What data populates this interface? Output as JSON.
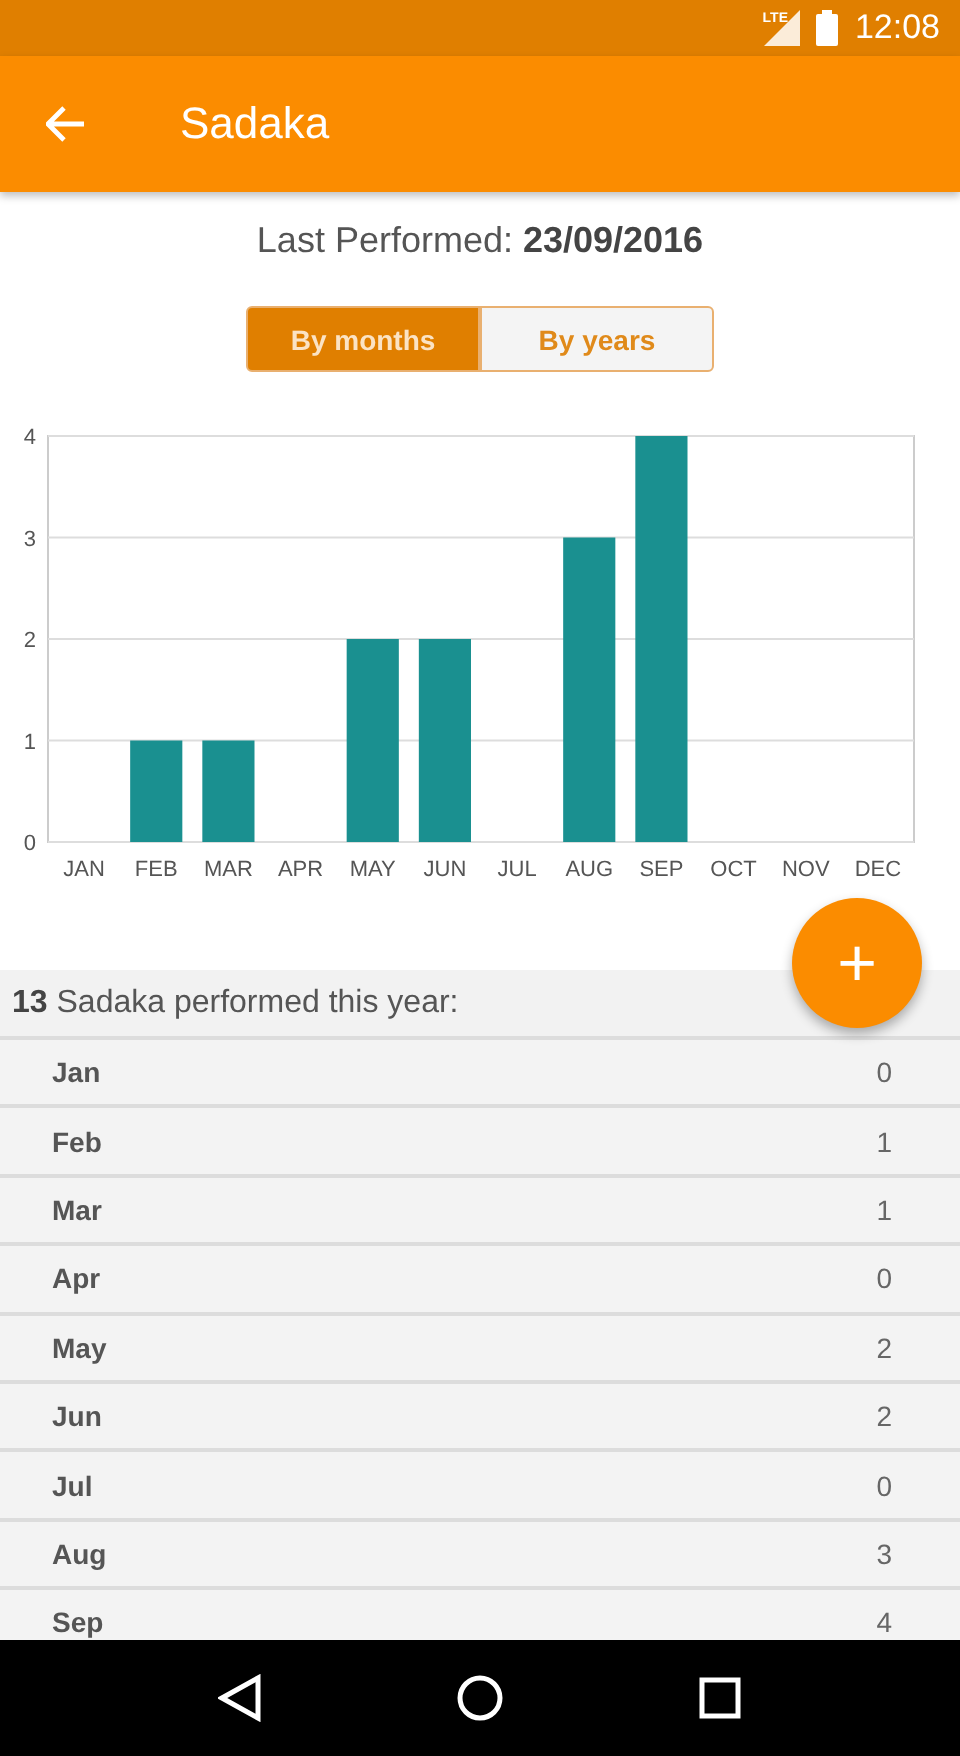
{
  "status_bar": {
    "network": "LTE",
    "time": "12:08"
  },
  "app_bar": {
    "title": "Sadaka"
  },
  "last_performed": "Last Performed: **23/09/2016**",
  "tabs": [
    {
      "label": "By months",
      "selected": true
    },
    {
      "label": "By years",
      "selected": false
    }
  ],
  "chart_data": {
    "type": "bar",
    "categories": [
      "JAN",
      "FEB",
      "MAR",
      "APR",
      "MAY",
      "JUN",
      "JUL",
      "AUG",
      "SEP",
      "OCT",
      "NOV",
      "DEC"
    ],
    "grid": true,
    "series": [
      {
        "color": "#1a9090",
        "values": [
          0,
          1,
          1,
          0,
          2,
          2,
          0,
          3,
          4,
          0,
          0,
          0
        ]
      }
    ],
    "ylim": [
      0,
      4
    ],
    "yticks": [
      0,
      1,
      2,
      3,
      4
    ]
  },
  "fab": {
    "label": "+"
  },
  "summary": "**13** Sadaka performed this year:",
  "rows": [
    {
      "month": "Jan",
      "count": "0"
    },
    {
      "month": "Feb",
      "count": "1"
    },
    {
      "month": "Mar",
      "count": "1"
    },
    {
      "month": "Apr",
      "count": "0"
    },
    {
      "month": "May",
      "count": "2"
    },
    {
      "month": "Jun",
      "count": "2"
    },
    {
      "month": "Jul",
      "count": "0"
    },
    {
      "month": "Aug",
      "count": "3"
    },
    {
      "month": "Sep",
      "count": "4"
    }
  ]
}
